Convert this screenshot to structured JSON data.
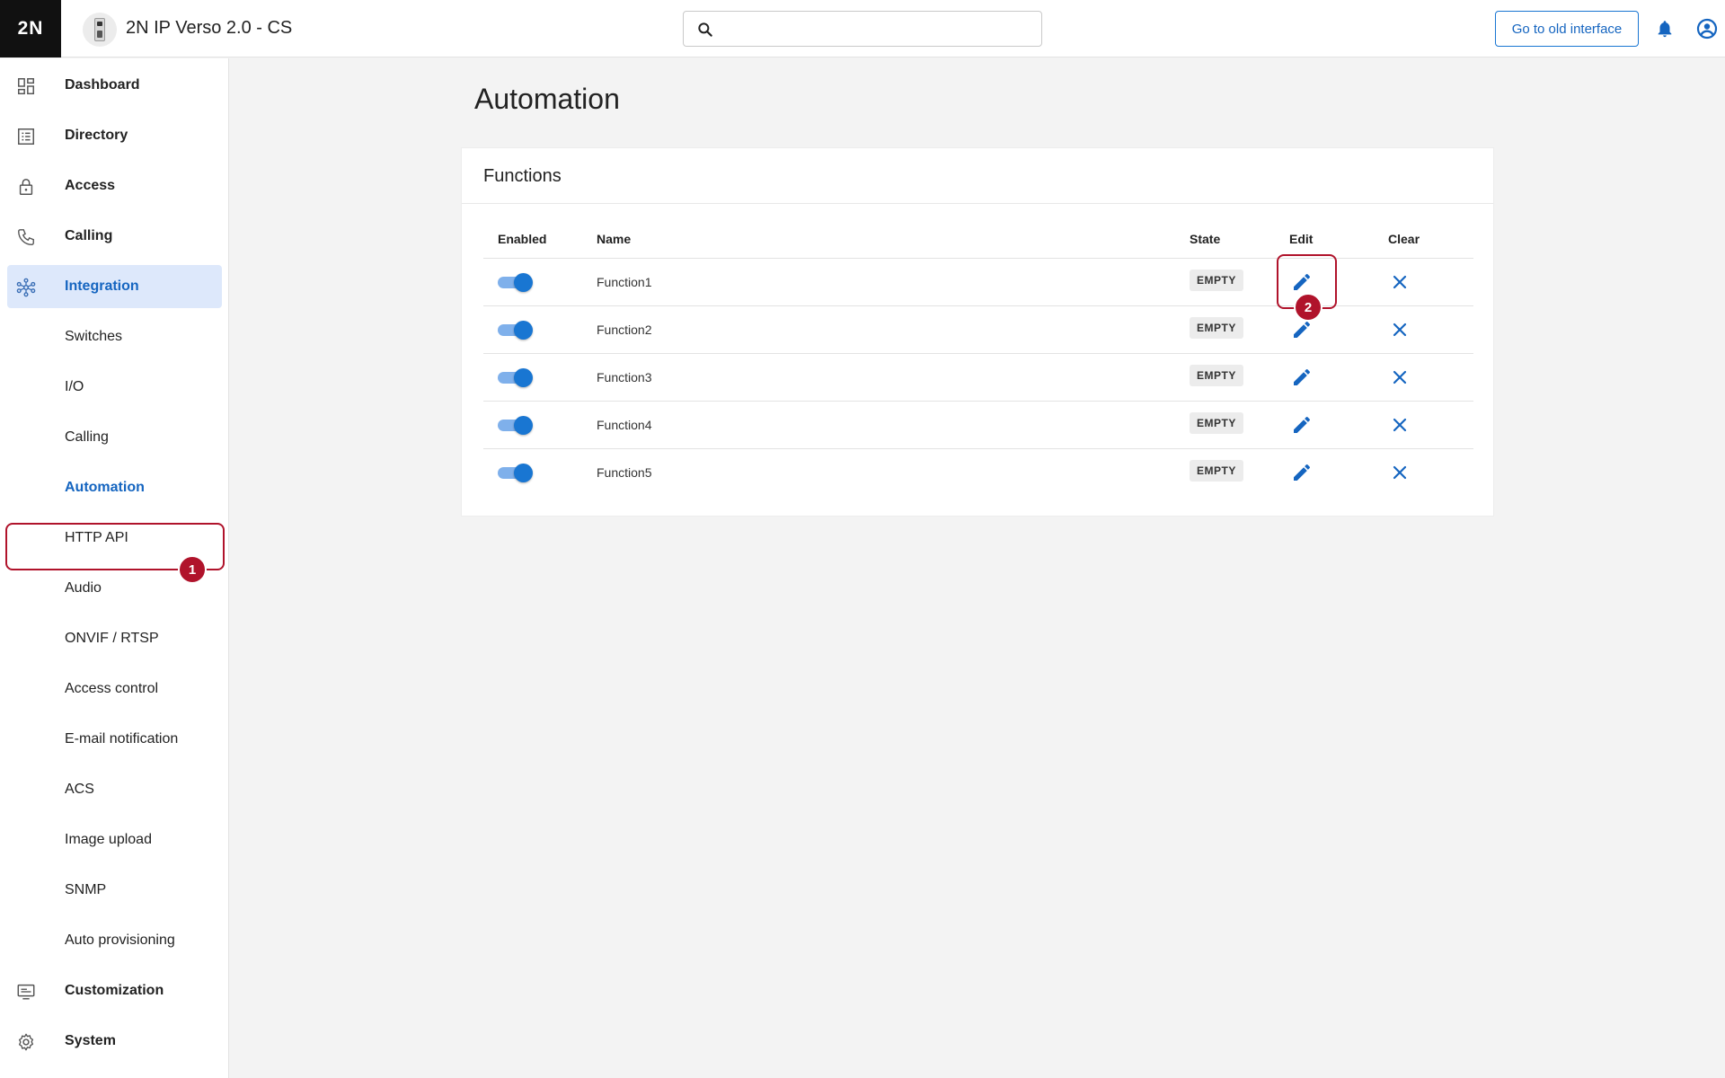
{
  "header": {
    "logo": "2N",
    "title": "2N IP Verso 2.0 - CS",
    "search": {
      "value": "",
      "placeholder": ""
    },
    "old_interface_label": "Go to old interface"
  },
  "sidebar": {
    "items": [
      {
        "label": "Dashboard",
        "icon": "dashboard-icon"
      },
      {
        "label": "Directory",
        "icon": "directory-icon"
      },
      {
        "label": "Access",
        "icon": "lock-icon"
      },
      {
        "label": "Calling",
        "icon": "phone-icon"
      },
      {
        "label": "Integration",
        "icon": "integration-icon",
        "active": true
      }
    ],
    "sub_items": [
      "Switches",
      "I/O",
      "Calling",
      "Automation",
      "HTTP API",
      "Audio",
      "ONVIF / RTSP",
      "Access control",
      "E-mail notification",
      "ACS",
      "Image upload",
      "SNMP",
      "Auto provisioning"
    ],
    "bottom_items": [
      {
        "label": "Customization",
        "icon": "monitor-icon"
      },
      {
        "label": "System",
        "icon": "gear-icon"
      }
    ],
    "selected_sub_item": "Automation"
  },
  "main": {
    "page_title": "Automation",
    "card_title": "Functions",
    "columns": [
      "Enabled",
      "Name",
      "State",
      "Edit",
      "Clear"
    ],
    "rows": [
      {
        "enabled": true,
        "name": "Function1",
        "state": "EMPTY"
      },
      {
        "enabled": true,
        "name": "Function2",
        "state": "EMPTY"
      },
      {
        "enabled": true,
        "name": "Function3",
        "state": "EMPTY"
      },
      {
        "enabled": true,
        "name": "Function4",
        "state": "EMPTY"
      },
      {
        "enabled": true,
        "name": "Function5",
        "state": "EMPTY"
      }
    ]
  },
  "annotations": {
    "step1": "1",
    "step2": "2"
  },
  "colors": {
    "accent": "#1976d2",
    "annotation": "#b0132b",
    "active_bg": "#dde8fb"
  }
}
